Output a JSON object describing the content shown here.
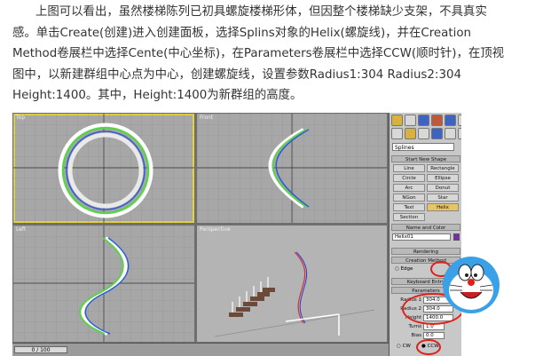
{
  "paragraph": {
    "line1": "上图可以看出，虽然楼梯陈列已初具螺旋楼梯形体，但因整个楼梯缺少支架，不具真实",
    "line2": "感。单击Create(创建)进入创建面板，选择Splins对象的Helix(螺旋线)，并在Creation",
    "line3": "Method卷展栏中选择Cente(中心坐标)，在Parameters卷展栏中选择CCW(顺时针)，在顶视",
    "line4": "图中，以新建群组中心点为中心，创建螺旋线，设置参数Radius1:304 Radius2:304",
    "line5": "Height:1400。其中，Height:1400为新群组的高度。"
  },
  "screenshot": {
    "viewports": {
      "top": "Top",
      "front": "Front",
      "left": "Left",
      "perspective": "Perspective"
    },
    "timeline": "0 / 100",
    "panel": {
      "category": "Splines",
      "auto_grid": "Start New Shape",
      "objects": [
        "Line",
        "Rectangle",
        "Circle",
        "Ellipse",
        "Arc",
        "Donut",
        "NGon",
        "Star",
        "Text",
        "Helix",
        "Section"
      ],
      "active_object": "Helix",
      "name_color_header": "Name and Color",
      "name_value": "Helix01",
      "rendering_header": "Rendering",
      "creation_method_header": "Creation Method",
      "edge_option": "Edge",
      "keyboard_entry_header": "Keyboard Entry",
      "parameters_header": "Parameters",
      "params": [
        {
          "label": "Radius 1",
          "value": "304.0"
        },
        {
          "label": "Radius 2",
          "value": "304.0"
        },
        {
          "label": "Height",
          "value": "1400.0"
        },
        {
          "label": "Turns",
          "value": "1.0"
        },
        {
          "label": "Bias",
          "value": "0.0"
        }
      ],
      "cw": "CW",
      "ccw": "CCW"
    },
    "colors": {
      "highlight_circle": "#e0201a",
      "active_viewport_border": "#e5d33a",
      "helix_blue": "#2f5bd8",
      "helix_green": "#5bd24a"
    }
  }
}
